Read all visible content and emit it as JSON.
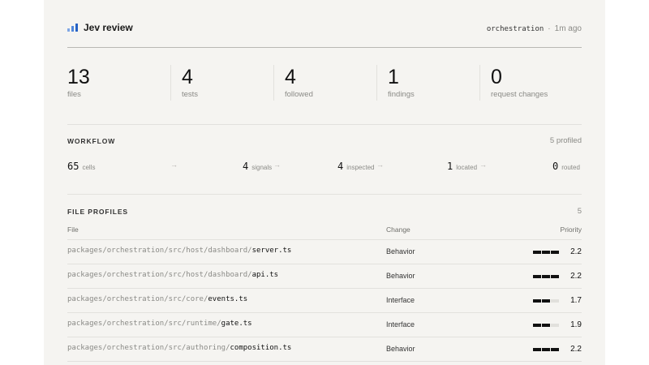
{
  "header": {
    "title": "Jev review",
    "scope": "orchestration",
    "separator": "·",
    "time": "1m ago"
  },
  "colors": {
    "accent": "#2561c4",
    "panel": "#f5f4f1"
  },
  "icons": {
    "logo": "bar-chart-icon",
    "arrow": "arrow-right-icon"
  },
  "stats": [
    {
      "value": "13",
      "label": "files"
    },
    {
      "value": "4",
      "label": "tests"
    },
    {
      "value": "4",
      "label": "followed"
    },
    {
      "value": "1",
      "label": "findings"
    },
    {
      "value": "0",
      "label": "request changes"
    }
  ],
  "workflow": {
    "heading": "WORKFLOW",
    "count": "5 profiled",
    "arrow": "→",
    "steps": [
      {
        "value": "65",
        "label": "cells"
      },
      {
        "value": "4",
        "label": "signals"
      },
      {
        "value": "4",
        "label": "inspected"
      },
      {
        "value": "1",
        "label": "located"
      },
      {
        "value": "0",
        "label": "routed"
      }
    ]
  },
  "profiles": {
    "heading": "FILE PROFILES",
    "count": "5",
    "columns": {
      "file": "File",
      "change": "Change",
      "priority": "Priority"
    },
    "rows": [
      {
        "dir": "packages/orchestration/src/host/dashboard/",
        "base": "server.ts",
        "change": "Behavior",
        "priority": "2.2",
        "level": 3
      },
      {
        "dir": "packages/orchestration/src/host/dashboard/",
        "base": "api.ts",
        "change": "Behavior",
        "priority": "2.2",
        "level": 3
      },
      {
        "dir": "packages/orchestration/src/core/",
        "base": "events.ts",
        "change": "Interface",
        "priority": "1.7",
        "level": 2
      },
      {
        "dir": "packages/orchestration/src/runtime/",
        "base": "gate.ts",
        "change": "Interface",
        "priority": "1.9",
        "level": 2
      },
      {
        "dir": "packages/orchestration/src/authoring/",
        "base": "composition.ts",
        "change": "Behavior",
        "priority": "2.2",
        "level": 3
      }
    ]
  }
}
